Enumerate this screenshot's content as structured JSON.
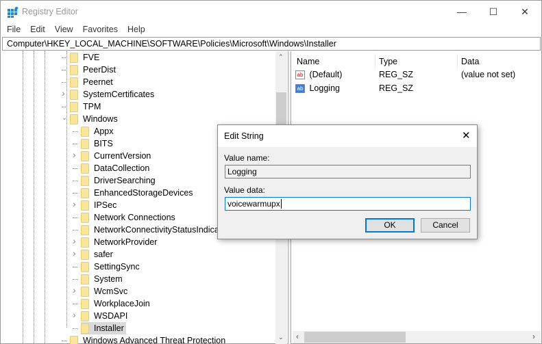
{
  "window": {
    "title": "Registry Editor",
    "minimize": "—",
    "maximize": "☐",
    "close": "✕"
  },
  "menu": [
    "File",
    "Edit",
    "View",
    "Favorites",
    "Help"
  ],
  "address": "Computer\\HKEY_LOCAL_MACHINE\\SOFTWARE\\Policies\\Microsoft\\Windows\\Installer",
  "tree": [
    {
      "label": "FVE",
      "level": 1,
      "expand": "none"
    },
    {
      "label": "PeerDist",
      "level": 1,
      "expand": "none"
    },
    {
      "label": "Peernet",
      "level": 1,
      "expand": "none"
    },
    {
      "label": "SystemCertificates",
      "level": 1,
      "expand": "collapsed"
    },
    {
      "label": "TPM",
      "level": 1,
      "expand": "none"
    },
    {
      "label": "Windows",
      "level": 1,
      "expand": "expanded"
    },
    {
      "label": "Appx",
      "level": 2,
      "expand": "none"
    },
    {
      "label": "BITS",
      "level": 2,
      "expand": "none"
    },
    {
      "label": "CurrentVersion",
      "level": 2,
      "expand": "collapsed"
    },
    {
      "label": "DataCollection",
      "level": 2,
      "expand": "none"
    },
    {
      "label": "DriverSearching",
      "level": 2,
      "expand": "none"
    },
    {
      "label": "EnhancedStorageDevices",
      "level": 2,
      "expand": "none"
    },
    {
      "label": "IPSec",
      "level": 2,
      "expand": "collapsed"
    },
    {
      "label": "Network Connections",
      "level": 2,
      "expand": "none"
    },
    {
      "label": "NetworkConnectivityStatusIndicator",
      "level": 2,
      "expand": "none"
    },
    {
      "label": "NetworkProvider",
      "level": 2,
      "expand": "collapsed"
    },
    {
      "label": "safer",
      "level": 2,
      "expand": "collapsed"
    },
    {
      "label": "SettingSync",
      "level": 2,
      "expand": "none"
    },
    {
      "label": "System",
      "level": 2,
      "expand": "none"
    },
    {
      "label": "WcmSvc",
      "level": 2,
      "expand": "collapsed"
    },
    {
      "label": "WorkplaceJoin",
      "level": 2,
      "expand": "none"
    },
    {
      "label": "WSDAPI",
      "level": 2,
      "expand": "collapsed"
    },
    {
      "label": "Installer",
      "level": 2,
      "expand": "none",
      "selected": true
    },
    {
      "label": "Windows Advanced Threat Protection",
      "level": 1,
      "expand": "none"
    }
  ],
  "list": {
    "columns": [
      "Name",
      "Type",
      "Data"
    ],
    "rows": [
      {
        "name": "(Default)",
        "type": "REG_SZ",
        "data": "(value not set)"
      },
      {
        "name": "Logging",
        "type": "REG_SZ",
        "data": ""
      }
    ]
  },
  "dialog": {
    "title": "Edit String",
    "value_name_label": "Value name:",
    "value_name": "Logging",
    "value_data_label": "Value data:",
    "value_data": "voicewarmupx",
    "ok": "OK",
    "cancel": "Cancel",
    "close": "✕"
  },
  "colors": {
    "accent": "#0078d7",
    "folder": "#fbe59a"
  }
}
